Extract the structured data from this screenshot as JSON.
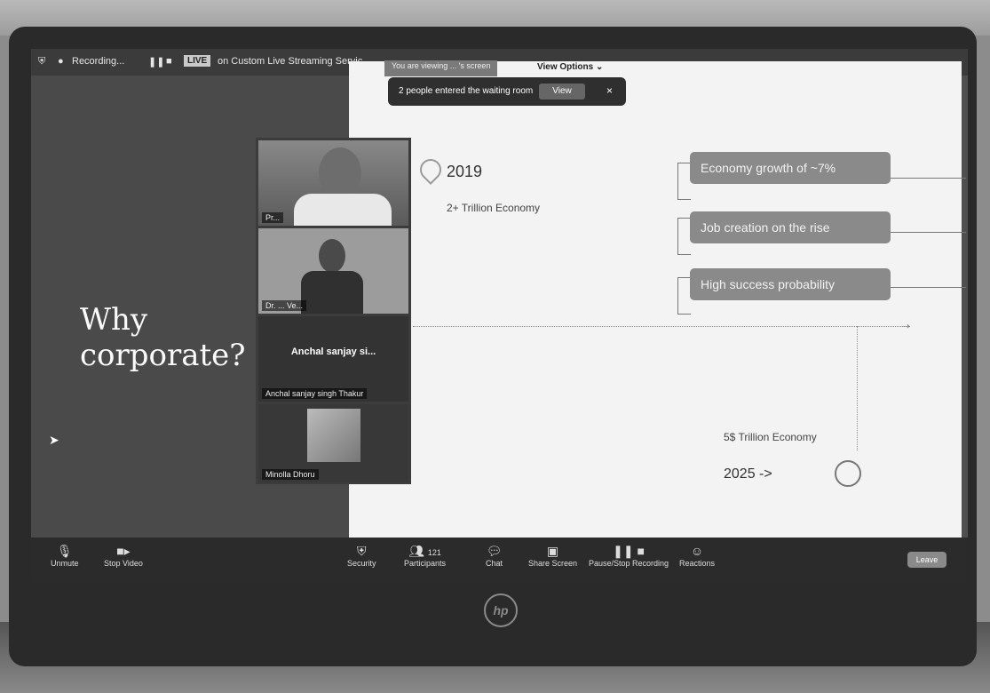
{
  "status_bar": {
    "recording_label": "Recording...",
    "live_badge": "LIVE",
    "streaming_label": "on Custom Live Streaming Servic"
  },
  "share_bar": {
    "viewing_label": "You are viewing ... 's screen",
    "view_options": "View Options ⌄"
  },
  "notification": {
    "message": "2 people entered the waiting room",
    "view_button": "View",
    "close": "×"
  },
  "slide": {
    "left_title_line1": "Why",
    "left_title_line2": "corporate?",
    "year_start": "2019",
    "start_caption": "2+ Trillion Economy",
    "pills": [
      "Economy growth of ~7%",
      "Job creation on the rise",
      "High success probability"
    ],
    "end_caption": "5$ Trillion Economy",
    "year_end": "2025 ->"
  },
  "participants": [
    {
      "name": "Pr...",
      "display": ""
    },
    {
      "name": "Dr. ... Ve...",
      "display": ""
    },
    {
      "name": "Anchal sanjay singh Thakur",
      "display": "Anchal sanjay si..."
    },
    {
      "name": "Minolla Dhoru",
      "display": ""
    }
  ],
  "toolbar": {
    "items": [
      {
        "icon": "mic-icon",
        "label": "Unmute"
      },
      {
        "icon": "video-icon",
        "label": "Stop Video"
      },
      {
        "icon": "shield-icon",
        "label": "Security"
      },
      {
        "icon": "participants-icon",
        "label": "Participants",
        "count": "121"
      },
      {
        "icon": "chat-icon",
        "label": "Chat"
      },
      {
        "icon": "share-icon",
        "label": "Share Screen"
      },
      {
        "icon": "record-icon",
        "label": "Pause/Stop Recording"
      },
      {
        "icon": "reactions-icon",
        "label": "Reactions"
      }
    ],
    "leave": "Leave"
  },
  "device": {
    "brand": "hp"
  }
}
